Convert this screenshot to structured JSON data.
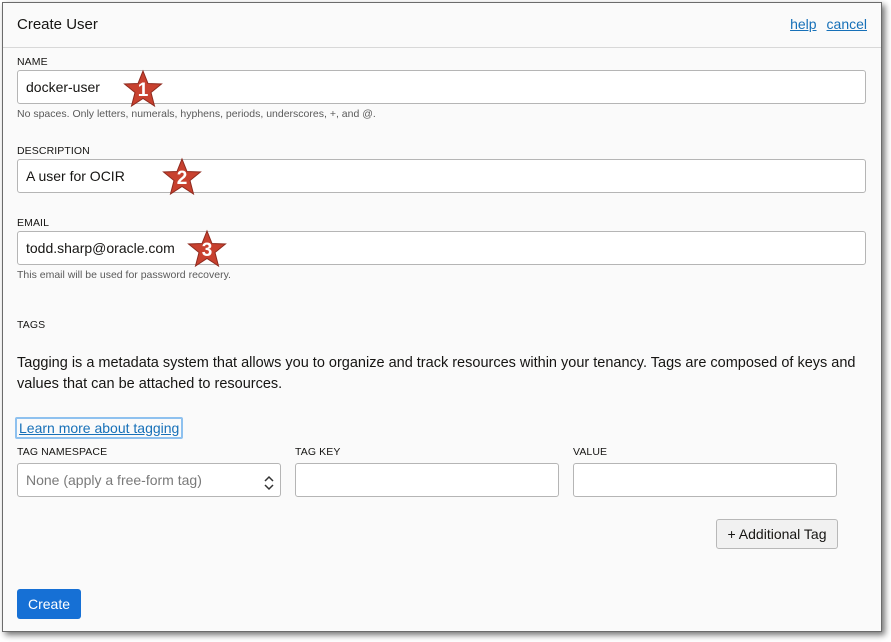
{
  "header": {
    "title": "Create User",
    "help_label": "help",
    "cancel_label": "cancel"
  },
  "name": {
    "label": "NAME",
    "value": "docker-user",
    "hint": "No spaces. Only letters, numerals, hyphens, periods, underscores, +, and @."
  },
  "description": {
    "label": "DESCRIPTION",
    "value": "A user for OCIR"
  },
  "email": {
    "label": "EMAIL",
    "value": "todd.sharp@oracle.com",
    "hint": "This email will be used for password recovery."
  },
  "tags": {
    "heading": "TAGS",
    "description": "Tagging is a metadata system that allows you to organize and track resources within your tenancy. Tags are composed of keys and values that can be attached to resources.",
    "learn_more_label": "Learn more about tagging",
    "namespace_label": "TAG NAMESPACE",
    "namespace_value": "None (apply a free-form tag)",
    "key_label": "TAG KEY",
    "key_value": "",
    "value_label": "VALUE",
    "value_value": "",
    "add_tag_label": "+ Additional Tag"
  },
  "actions": {
    "create_label": "Create"
  },
  "annotations": {
    "star_1": "1",
    "star_2": "2",
    "star_3": "3",
    "star_color": "#c8412f"
  },
  "colors": {
    "link": "#1670b8",
    "primary_button": "#1670d5",
    "dialog_background": "#fafafa"
  }
}
